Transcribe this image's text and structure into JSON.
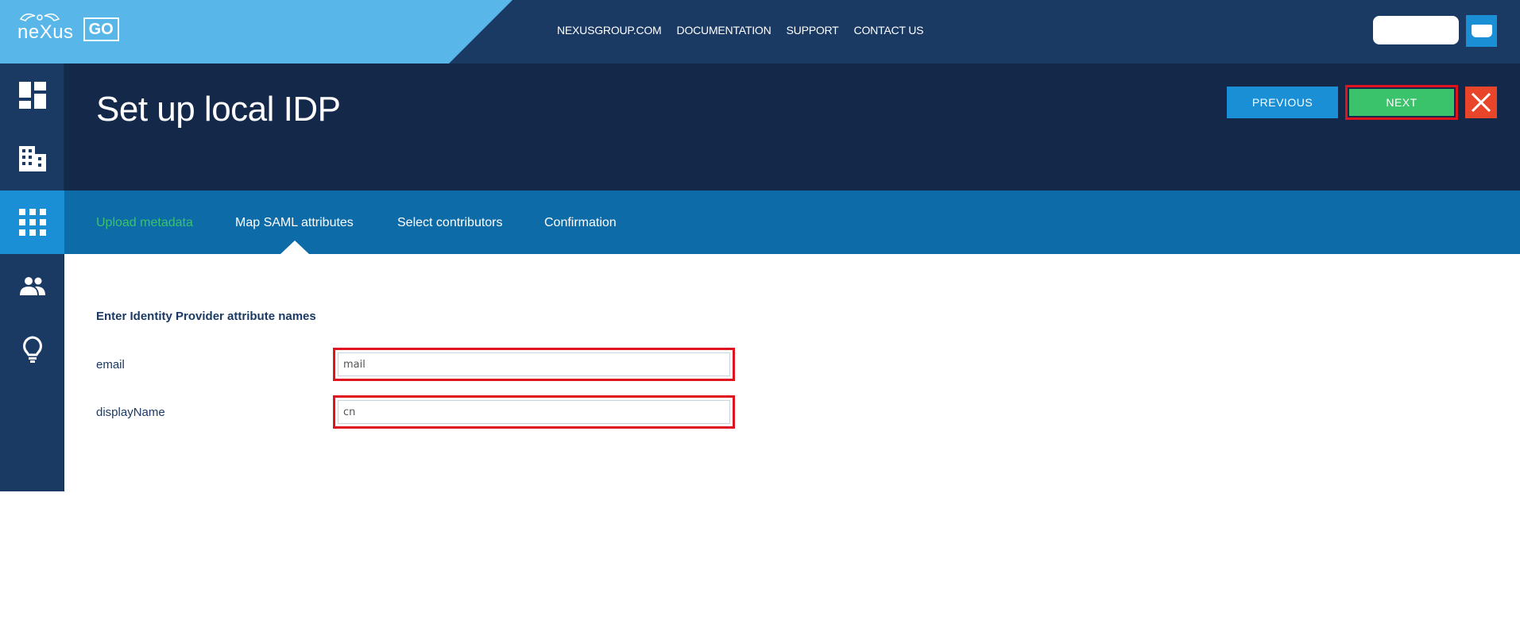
{
  "brand": {
    "logo_text": "neXus",
    "logo_badge": "GO"
  },
  "topnav": [
    {
      "label": "NEXUSGROUP.COM"
    },
    {
      "label": "DOCUMENTATION"
    },
    {
      "label": "SUPPORT"
    },
    {
      "label": "CONTACT US"
    }
  ],
  "sidebar": {
    "items": [
      {
        "icon": "dashboard-icon",
        "active": false
      },
      {
        "icon": "building-icon",
        "active": false
      },
      {
        "icon": "apps-grid-icon",
        "active": true
      },
      {
        "icon": "people-icon",
        "active": false
      },
      {
        "icon": "lightbulb-icon",
        "active": false
      }
    ]
  },
  "page": {
    "title": "Set up local IDP"
  },
  "actions": {
    "previous_label": "PREVIOUS",
    "next_label": "NEXT"
  },
  "tabs": [
    {
      "label": "Upload metadata",
      "state": "done"
    },
    {
      "label": "Map SAML attributes",
      "state": "active"
    },
    {
      "label": "Select contributors",
      "state": "pending"
    },
    {
      "label": "Confirmation",
      "state": "pending"
    }
  ],
  "form": {
    "section_title": "Enter Identity Provider attribute names",
    "fields": [
      {
        "label": "email",
        "value": "mail"
      },
      {
        "label": "displayName",
        "value": "cn"
      }
    ]
  },
  "colors": {
    "topbar": "#1b3a63",
    "accent_blue": "#1a8fd6",
    "success_green": "#3ac36b",
    "close_red": "#e9452a",
    "highlight_red": "#e0141e"
  }
}
